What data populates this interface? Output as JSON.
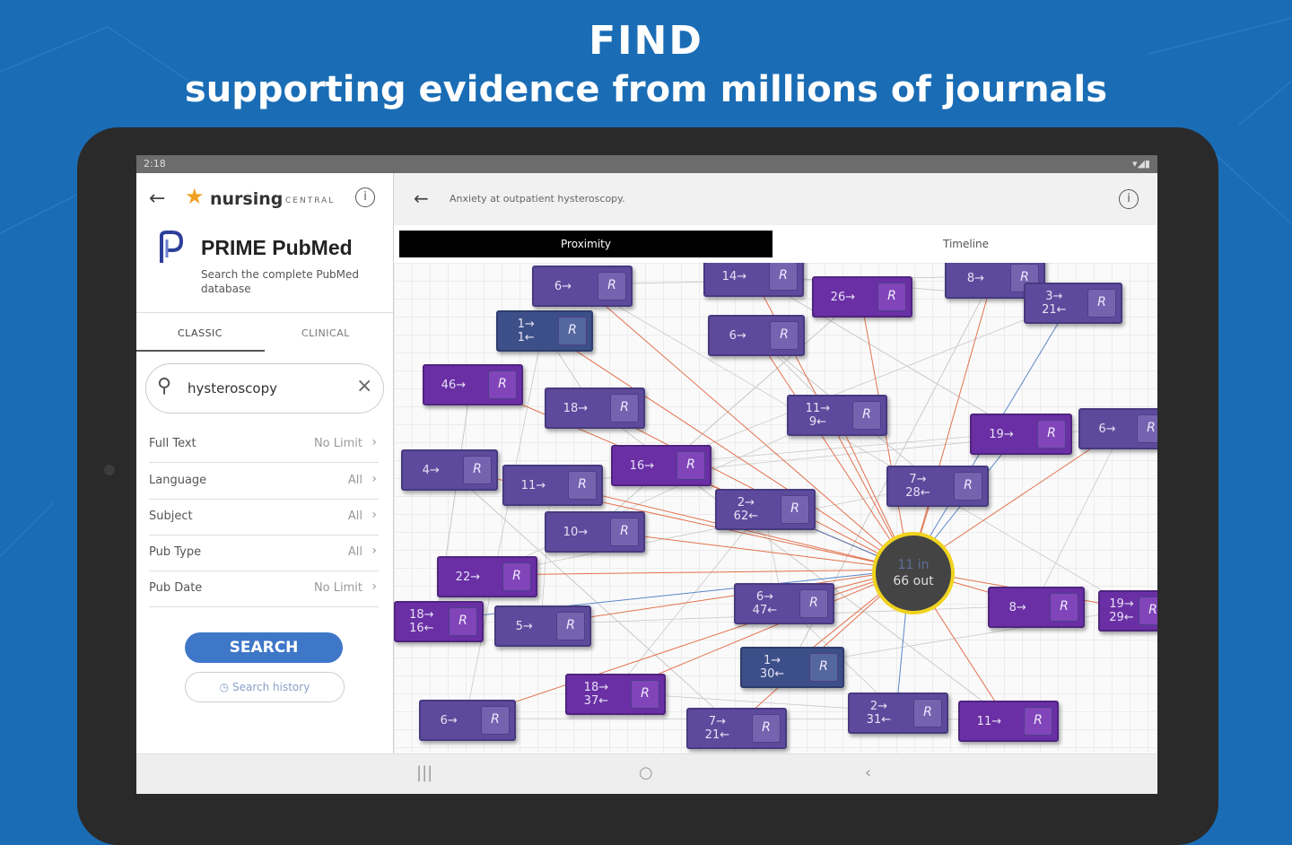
{
  "headline": {
    "title": "FIND",
    "subtitle": "supporting evidence from millions of journals"
  },
  "status": {
    "time": "2:18",
    "icons": "▾◢▮"
  },
  "left_panel": {
    "back_icon": "←",
    "brand": {
      "word": "nursing",
      "central": "CENTRAL",
      "star_icon": "star-icon"
    },
    "info_icon": "i",
    "app_title": "PRIME PubMed",
    "app_subtitle": "Search the complete PubMed database",
    "tabs": [
      "CLASSIC",
      "CLINICAL"
    ],
    "search": {
      "value": "hysteroscopy",
      "clear": "×"
    },
    "filters": [
      {
        "label": "Full Text",
        "value": "No Limit"
      },
      {
        "label": "Language",
        "value": "All"
      },
      {
        "label": "Subject",
        "value": "All"
      },
      {
        "label": "Pub Type",
        "value": "All"
      },
      {
        "label": "Pub Date",
        "value": "No Limit"
      }
    ],
    "search_button": "SEARCH",
    "history_button": "Search history",
    "history_icon": "◷"
  },
  "right_panel": {
    "back_icon": "←",
    "title": "Anxiety at outpatient hysteroscopy.",
    "info_icon": "i",
    "view_tabs": [
      "Proximity",
      "Timeline"
    ],
    "center_node": {
      "in": "11 in",
      "out": "66 out"
    },
    "node_button": "R",
    "nodes": [
      {
        "l1": "6→",
        "l2": ""
      },
      {
        "l1": "14→",
        "l2": ""
      },
      {
        "l1": "26→",
        "l2": ""
      },
      {
        "l1": "8→",
        "l2": ""
      },
      {
        "l1": "3→",
        "l2": "21←"
      },
      {
        "l1": "1→",
        "l2": "1←"
      },
      {
        "l1": "6→",
        "l2": ""
      },
      {
        "l1": "46→",
        "l2": ""
      },
      {
        "l1": "18→",
        "l2": ""
      },
      {
        "l1": "11→",
        "l2": "9←"
      },
      {
        "l1": "19→",
        "l2": ""
      },
      {
        "l1": "6→",
        "l2": ""
      },
      {
        "l1": "4→",
        "l2": ""
      },
      {
        "l1": "16→",
        "l2": ""
      },
      {
        "l1": "11→",
        "l2": ""
      },
      {
        "l1": "7→",
        "l2": "28←"
      },
      {
        "l1": "2→",
        "l2": "62←"
      },
      {
        "l1": "10→",
        "l2": ""
      },
      {
        "l1": "22→",
        "l2": ""
      },
      {
        "l1": "6→",
        "l2": "47←"
      },
      {
        "l1": "8→",
        "l2": ""
      },
      {
        "l1": "19→",
        "l2": "29←"
      },
      {
        "l1": "18→",
        "l2": "16←"
      },
      {
        "l1": "5→",
        "l2": ""
      },
      {
        "l1": "1→",
        "l2": "30←"
      },
      {
        "l1": "18→",
        "l2": "37←"
      },
      {
        "l1": "6→",
        "l2": ""
      },
      {
        "l1": "7→",
        "l2": "21←"
      },
      {
        "l1": "2→",
        "l2": "31←"
      },
      {
        "l1": "11→",
        "l2": ""
      }
    ]
  },
  "nav": {
    "recents": "|||",
    "home": "○",
    "back": "‹"
  },
  "colors": {
    "background": "#1a6db5",
    "node": "#5e4a9c",
    "node_violet": "#6a2fa5",
    "node_blue": "#3c4f88",
    "center_ring": "#f0d31e",
    "edge_out": "#e2724e",
    "edge_in": "#5a86c8"
  }
}
